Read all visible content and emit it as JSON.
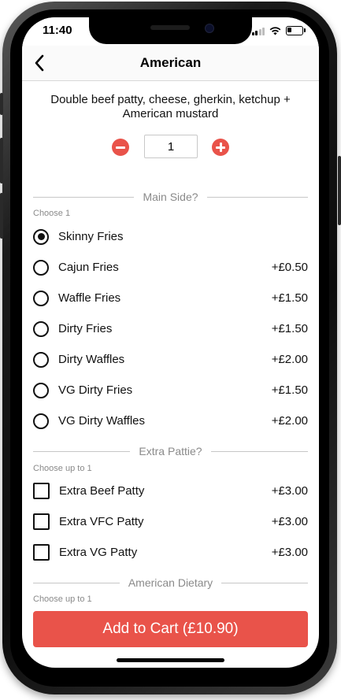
{
  "status_bar": {
    "time": "11:40"
  },
  "nav": {
    "title": "American"
  },
  "product": {
    "description": "Double beef patty, cheese, gherkin, ketchup + American mustard"
  },
  "quantity": {
    "value": "1"
  },
  "main_side": {
    "heading": "Main Side?",
    "hint": "Choose 1",
    "options": [
      {
        "label": "Skinny Fries",
        "price": "",
        "selected": true
      },
      {
        "label": "Cajun Fries",
        "price": "+£0.50",
        "selected": false
      },
      {
        "label": "Waffle Fries",
        "price": "+£1.50",
        "selected": false
      },
      {
        "label": "Dirty Fries",
        "price": "+£1.50",
        "selected": false
      },
      {
        "label": "Dirty Waffles",
        "price": "+£2.00",
        "selected": false
      },
      {
        "label": "VG Dirty Fries",
        "price": "+£1.50",
        "selected": false
      },
      {
        "label": "VG Dirty Waffles",
        "price": "+£2.00",
        "selected": false
      }
    ]
  },
  "extra_pattie": {
    "heading": "Extra Pattie?",
    "hint": "Choose up to 1",
    "options": [
      {
        "label": "Extra Beef Patty",
        "price": "+£3.00",
        "checked": false
      },
      {
        "label": "Extra VFC Patty",
        "price": "+£3.00",
        "checked": false
      },
      {
        "label": "Extra VG Patty",
        "price": "+£3.00",
        "checked": false
      }
    ]
  },
  "american_dietary": {
    "heading": "American Dietary",
    "hint": "Choose up to 1"
  },
  "cart_button": {
    "label": "Add to Cart (£10.90)"
  },
  "colors": {
    "accent": "#e9534a"
  }
}
